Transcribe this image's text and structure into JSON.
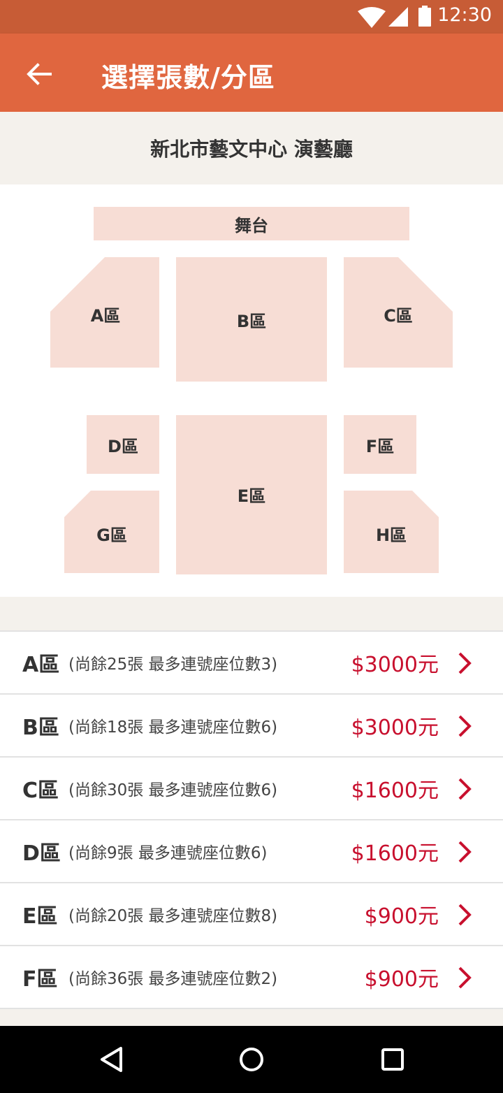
{
  "status_bar": {
    "time": "12:30",
    "icons": [
      "wifi-icon",
      "signal-icon",
      "battery-icon"
    ]
  },
  "app_bar": {
    "title": "選擇張數/分區",
    "back_icon": "arrow-left-icon"
  },
  "venue": {
    "name": "新北市藝文中心 演藝廳"
  },
  "seat_map": {
    "stage": "舞台",
    "zones": {
      "A": "A區",
      "B": "B區",
      "C": "C區",
      "D": "D區",
      "E": "E區",
      "F": "F區",
      "G": "G區",
      "H": "H區"
    }
  },
  "ticket_list": [
    {
      "zone": "A區",
      "info": "(尚餘25張 最多連號座位數3)",
      "price": "$3000元"
    },
    {
      "zone": "B區",
      "info": "(尚餘18張 最多連號座位數6)",
      "price": "$3000元"
    },
    {
      "zone": "C區",
      "info": "(尚餘30張 最多連號座位數6)",
      "price": "$1600元"
    },
    {
      "zone": "D區",
      "info": "(尚餘9張 最多連號座位數6)",
      "price": "$1600元"
    },
    {
      "zone": "E區",
      "info": "(尚餘20張 最多連號座位數8)",
      "price": "$900元"
    },
    {
      "zone": "F區",
      "info": "(尚餘36張 最多連號座位數2)",
      "price": "$900元"
    }
  ],
  "colors": {
    "status_bar": "#c75c36",
    "app_bar": "#e0663f",
    "zone_fill": "#f7ddd5",
    "price": "#c8102e"
  },
  "nav_bar": {
    "icons": [
      "back-triangle-icon",
      "home-circle-icon",
      "recents-square-icon"
    ]
  }
}
